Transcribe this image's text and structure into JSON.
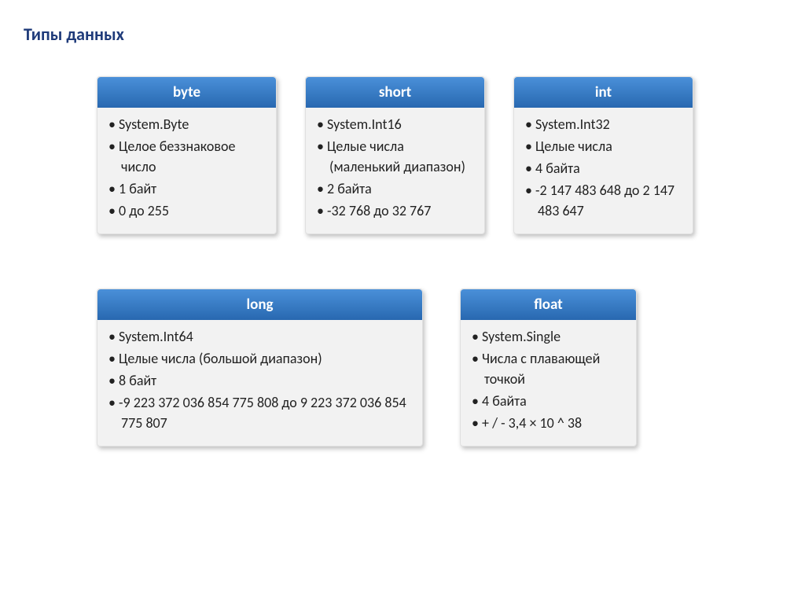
{
  "page_title": "Типы данных",
  "cards": [
    {
      "id": "byte",
      "title": "byte",
      "items": [
        "System.Byte",
        "Целое беззнаковое число",
        "1 байт",
        "0 до 255"
      ]
    },
    {
      "id": "short",
      "title": "short",
      "items": [
        "System.Int16",
        "Целые числа (маленький диапазон)",
        "2 байта",
        "-32 768 до 32 767"
      ]
    },
    {
      "id": "int",
      "title": "int",
      "items": [
        "System.Int32",
        "Целые числа",
        "4 байта",
        "-2 147 483 648 до 2 147 483 647"
      ]
    },
    {
      "id": "long",
      "title": "long",
      "items": [
        "System.Int64",
        "Целые числа (большой диапазон)",
        "8 байт",
        "-9 223 372 036 854 775 808 до 9 223 372 036 854 775 807"
      ]
    },
    {
      "id": "float",
      "title": "float",
      "items": [
        "System.Single",
        "Числа с плавающей точкой",
        "4 байта",
        "+ / - 3,4 × 10 ^ 38"
      ]
    }
  ]
}
